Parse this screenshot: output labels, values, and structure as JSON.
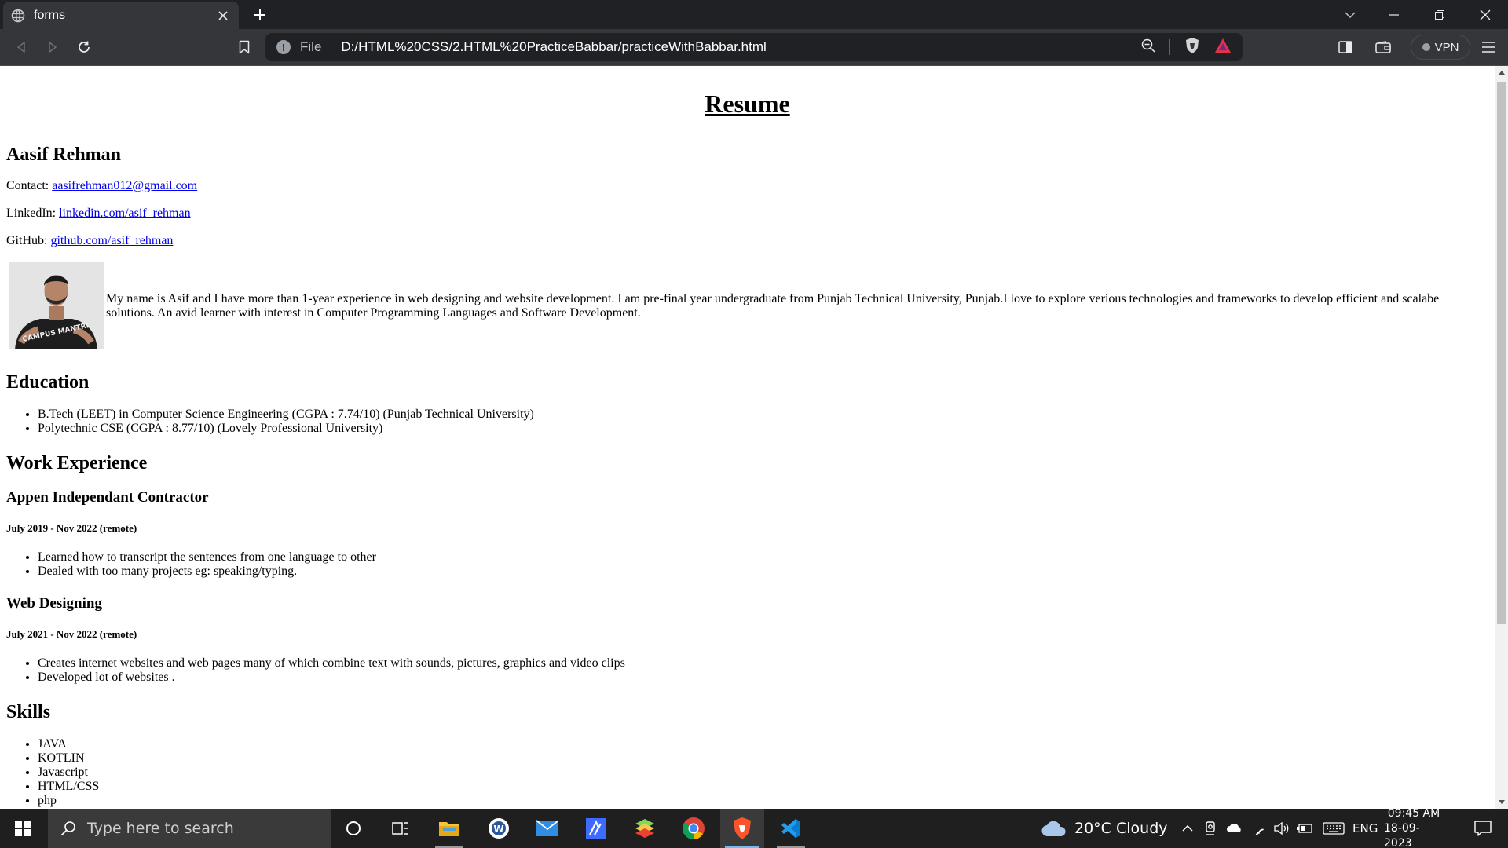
{
  "browser": {
    "tab_title": "forms",
    "omnibox": {
      "scheme_label": "File",
      "url": "D:/HTML%20CSS/2.HTML%20PracticeBabbar/practiceWithBabbar.html"
    },
    "vpn_label": "VPN"
  },
  "page": {
    "title": "Resume",
    "name": "Aasif Rehman",
    "contact": {
      "email_label": "Contact:",
      "email": "aasifrehman012@gmail.com",
      "linkedin_label": "LinkedIn:",
      "linkedin": "linkedin.com/asif_rehman",
      "github_label": "GitHub:",
      "github": "github.com/asif_rehman"
    },
    "about": "My name is Asif and I have more than 1-year experience in web designing and website development. I am pre-final year undergraduate from Punjab Technical University, Punjab.I love to explore verious technologies and frameworks to develop efficient and scalabe solutions. An avid learner with interest in Computer Programming Languages and Software Development.",
    "education": {
      "heading": "Education",
      "items": [
        "B.Tech (LEET) in Computer Science Engineering (CGPA : 7.74/10) (Punjab Technical University)",
        "Polytechnic CSE (CGPA : 8.77/10) (Lovely Professional University)"
      ]
    },
    "work": {
      "heading": "Work Experience",
      "jobs": [
        {
          "title": "Appen Independant Contractor",
          "period": "July 2019 - Nov 2022 (remote)",
          "points": [
            "Learned how to transcript the sentences from one language to other",
            "Dealed with too many projects eg: speaking/typing."
          ]
        },
        {
          "title": "Web Designing",
          "period": "July 2021 - Nov 2022 (remote)",
          "points": [
            "Creates internet websites and web pages many of which combine text with sounds, pictures, graphics and video clips",
            "Developed lot of websites ."
          ]
        }
      ]
    },
    "skills": {
      "heading": "Skills",
      "items": [
        "JAVA",
        "KOTLIN",
        "Javascript",
        "HTML/CSS",
        "php"
      ]
    },
    "photo_shirt_text": "CAMPUS MANTRI"
  },
  "taskbar": {
    "search_placeholder": "Type here to search",
    "weather": "20°C  Cloudy",
    "language": "ENG",
    "time": "09:45 AM",
    "date": "18-09-2023"
  }
}
